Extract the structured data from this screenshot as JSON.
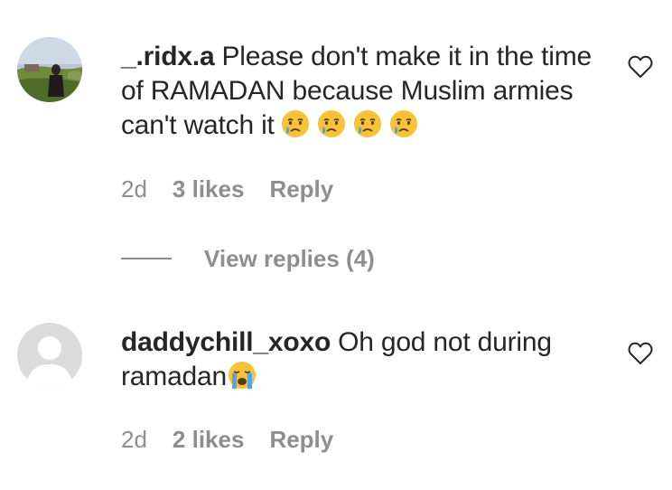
{
  "comments": [
    {
      "username": "_.ridx.a",
      "text": "Please don't make it in the time of RAMADAN because Muslim armies can't watch it",
      "emojis": [
        "crying-face",
        "crying-face",
        "crying-face",
        "crying-face"
      ],
      "time": "2d",
      "likes": "3 likes",
      "reply_label": "Reply",
      "view_replies": "View replies (4)"
    },
    {
      "username": "daddychill_xoxo",
      "text": "Oh god not during ramadan",
      "emojis": [
        "loudly-crying-face"
      ],
      "time": "2d",
      "likes": "2 likes",
      "reply_label": "Reply"
    }
  ],
  "icons": {
    "like": "heart-outline-icon",
    "default_avatar": "default-avatar-icon"
  },
  "colors": {
    "text": "#262626",
    "meta": "#8e8e8e",
    "background": "#ffffff"
  }
}
